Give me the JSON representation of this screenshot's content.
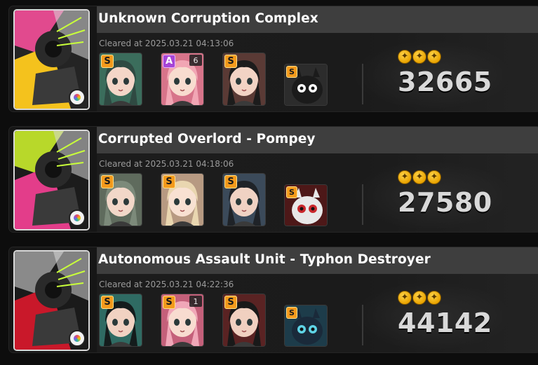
{
  "records": [
    {
      "title": "Unknown Corruption Complex",
      "cleared": "Cleared at 2025.03.21 04:13:06",
      "score": "32665",
      "agents": [
        {
          "rank": "S",
          "level": "",
          "hair": "#2f4a42",
          "skin": "#f4d6c8",
          "bg": "#3b6d5c"
        },
        {
          "rank": "A",
          "level": "6",
          "hair": "#f1a6b4",
          "skin": "#f8dccf",
          "bg": "#d7748a"
        },
        {
          "rank": "S",
          "level": "",
          "hair": "#1c1c1c",
          "skin": "#f2d3c4",
          "bg": "#5a3a35"
        }
      ],
      "bangboo": {
        "rank": "S",
        "bg": "#2c2c2c",
        "body": "#1b1b1b",
        "accent": "#ffffff"
      },
      "art": {
        "bg1": "#f4c21d",
        "bg2": "#e14a8e",
        "bg3": "#242424"
      }
    },
    {
      "title": "Corrupted Overlord - Pompey",
      "cleared": "Cleared at 2025.03.21 04:18:06",
      "score": "27580",
      "agents": [
        {
          "rank": "S",
          "level": "",
          "hair": "#7c8a7a",
          "skin": "#f2d7c8",
          "bg": "#5f6b5d"
        },
        {
          "rank": "S",
          "level": "",
          "hair": "#e9d6b0",
          "skin": "#f8e1d2",
          "bg": "#b79a82"
        },
        {
          "rank": "S",
          "level": "",
          "hair": "#1f2328",
          "skin": "#f0d2c3",
          "bg": "#3b4a5a"
        }
      ],
      "bangboo": {
        "rank": "S",
        "bg": "#4d1818",
        "body": "#e8e8e8",
        "accent": "#c9282c"
      },
      "art": {
        "bg1": "#e33d8a",
        "bg2": "#b8d82a",
        "bg3": "#1c1c1c"
      }
    },
    {
      "title": "Autonomous Assault Unit - Typhon Destroyer",
      "cleared": "Cleared at 2025.03.21 04:22:36",
      "score": "44142",
      "agents": [
        {
          "rank": "S",
          "level": "",
          "hair": "#141c1c",
          "skin": "#f1d2c2",
          "bg": "#2f6b63"
        },
        {
          "rank": "S",
          "level": "1",
          "hair": "#f0a7b8",
          "skin": "#f8dcd0",
          "bg": "#c4607a"
        },
        {
          "rank": "S",
          "level": "",
          "hair": "#191919",
          "skin": "#f0d0c0",
          "bg": "#5a2323"
        }
      ],
      "bangboo": {
        "rank": "S",
        "bg": "#1d3c4a",
        "body": "#1a2a3a",
        "accent": "#5fd4e6"
      },
      "art": {
        "bg1": "#c9182a",
        "bg2": "#8a8a8a",
        "bg3": "#1a1a1a"
      }
    }
  ],
  "icons": {
    "medal": "medal-icon",
    "rank_badge": "rank-badge-icon",
    "boss_badge": "boss-badge-icon"
  }
}
